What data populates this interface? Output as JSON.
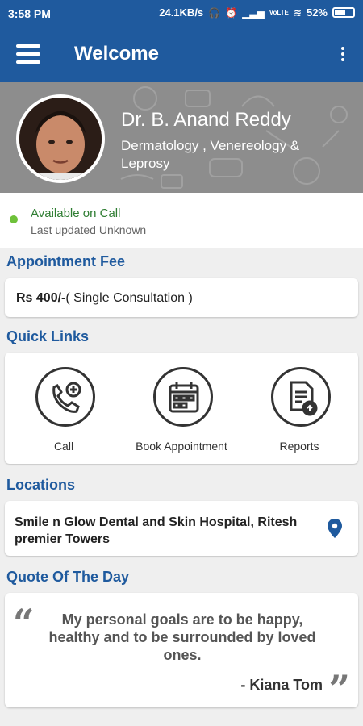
{
  "status_bar": {
    "time": "3:58 PM",
    "speed": "24.1KB/s",
    "network": "VoLTE",
    "battery": "52%"
  },
  "app_bar": {
    "title": "Welcome",
    "menu_icon": "hamburger-menu-icon",
    "more_icon": "more-vert-icon"
  },
  "doctor": {
    "name": "Dr. B. Anand Reddy",
    "specialty": "Dermatology , Venereology & Leprosy"
  },
  "availability": {
    "status": "Available on Call",
    "last_updated": "Last updated Unknown",
    "status_color": "#6ec13a"
  },
  "appointment_fee": {
    "title": "Appointment Fee",
    "amount": "Rs 400/-",
    "detail": "( Single Consultation )"
  },
  "quick_links": {
    "title": "Quick Links",
    "items": [
      {
        "label": "Call",
        "icon": "phone-plus-icon"
      },
      {
        "label": "Book Appointment",
        "icon": "calendar-icon"
      },
      {
        "label": "Reports",
        "icon": "report-upload-icon"
      }
    ]
  },
  "locations": {
    "title": "Locations",
    "items": [
      {
        "name": "Smile n Glow Dental and Skin Hospital, Ritesh premier Towers",
        "icon": "map-pin-icon"
      }
    ]
  },
  "quote": {
    "title": "Quote Of The Day",
    "text": "My personal goals are to be happy, healthy and to be surrounded by loved ones.",
    "author": "- Kiana Tom"
  },
  "colors": {
    "primary": "#1f5a9e",
    "background": "#efefef"
  }
}
